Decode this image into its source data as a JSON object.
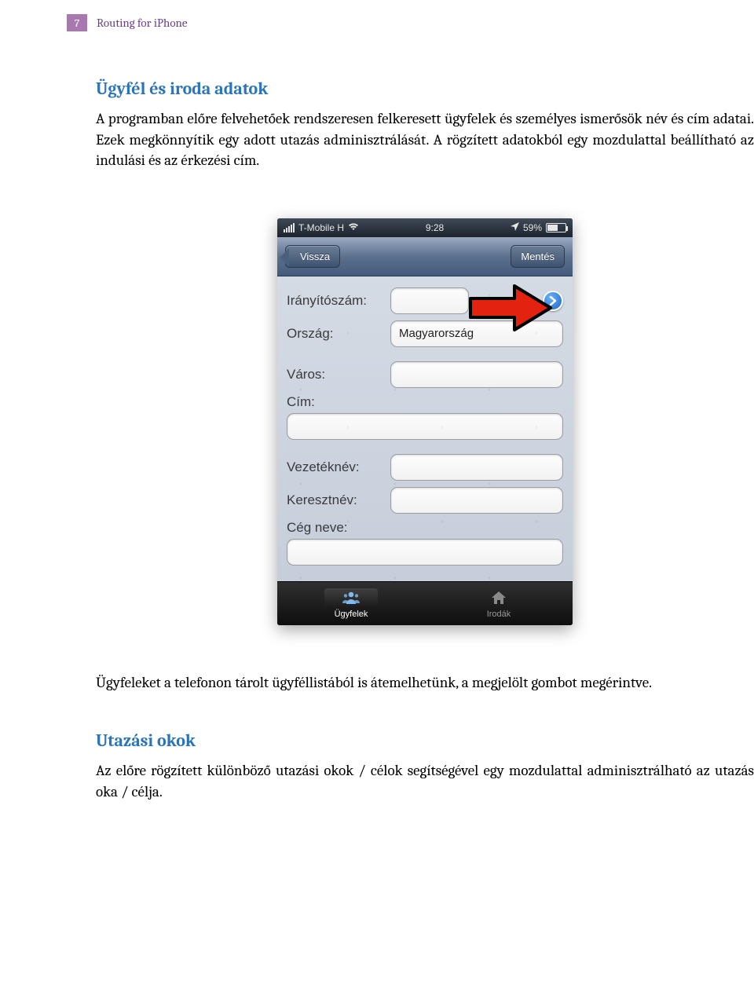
{
  "page_number": "7",
  "doc_title": "Routing for iPhone",
  "section1": {
    "heading": "Ügyfél és iroda adatok",
    "paragraph": "A programban előre felvehetőek rendszeresen felkeresett ügyfelek és személyes ismerősök név és cím adatai. Ezek megkönnyítik egy adott utazás adminisztrálását. A rögzített adatokból egy mozdulattal beállítható az indulási és az érkezési cím."
  },
  "phone": {
    "status": {
      "carrier": "T-Mobile H",
      "time": "9:28",
      "battery_pct": "59%"
    },
    "nav": {
      "back": "Vissza",
      "save": "Mentés"
    },
    "form": {
      "iranyitoszam_label": "Irányítószám:",
      "iranyitoszam_value": "",
      "orszag_label": "Ország:",
      "orszag_value": "Magyarország",
      "varos_label": "Város:",
      "varos_value": "",
      "cim_label": "Cím:",
      "cim_value": "",
      "vezeteknev_label": "Vezetéknév:",
      "vezeteknev_value": "",
      "keresztnev_label": "Keresztnév:",
      "keresztnev_value": "",
      "cegneve_label": "Cég neve:",
      "cegneve_value": ""
    },
    "tabs": {
      "ugyfelek": "Ügyfelek",
      "irodak": "Irodák"
    }
  },
  "section2": {
    "paragraph": "Ügyfeleket a telefonon tárolt ügyféllistából is átemelhetünk, a megjelölt gombot megérintve."
  },
  "section3": {
    "heading": "Utazási okok",
    "paragraph": "Az előre rögzített különböző utazási okok / célok segítségével egy mozdulattal adminisztrálható az utazás oka / célja."
  },
  "colors": {
    "heading": "#2b74b8",
    "header_accent": "#6a3f8a"
  }
}
